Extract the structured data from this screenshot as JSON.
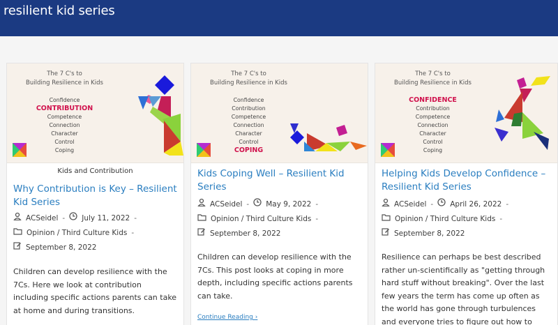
{
  "site": {
    "title": "resilient kid series"
  },
  "thumb": {
    "heading_line1": "The 7 C's to",
    "heading_line2": "Building Resilience in Kids",
    "items": [
      "Confidence",
      "Contribution",
      "Competence",
      "Connection",
      "Character",
      "Control",
      "Coping"
    ]
  },
  "posts": [
    {
      "thumb_highlight": "CONTRIBUTION",
      "category": "Kids and Contribution",
      "title": "Why Contribution is Key – Resilient Kid Series",
      "author": "ACSeidel",
      "date": "July 11, 2022",
      "categories": "Opinion / Third Culture Kids",
      "updated": "September 8, 2022",
      "excerpt": "Children can develop resilience with the 7Cs. Here we look at contribution including specific actions parents can take at home and during transitions."
    },
    {
      "thumb_highlight": "COPING",
      "title": "Kids Coping Well – Resilient Kid Series",
      "author": "ACSeidel",
      "date": "May 9, 2022",
      "categories": "Opinion / Third Culture Kids",
      "updated": "September 8, 2022",
      "excerpt": "Children can develop resilience with the 7Cs. This post looks at coping in more depth, including specific actions parents can take.",
      "read_more": "Continue Reading"
    },
    {
      "thumb_highlight": "CONFIDENCE",
      "title": "Helping Kids Develop Confidence – Resilient Kid Series",
      "author": "ACSeidel",
      "date": "April 26, 2022",
      "categories": "Opinion / Third Culture Kids",
      "updated": "September 8, 2022",
      "excerpt": "Resilience can perhaps be best described rather un-scientifically as \"getting through hard stuff without breaking\". Over the last few years the term has come up often as the world has gone through turbulences and everyone tries to figure out how to"
    }
  ],
  "colors": {
    "header": "#1b3a82",
    "link": "#2a7ec0",
    "highlight": "#d0114c"
  }
}
